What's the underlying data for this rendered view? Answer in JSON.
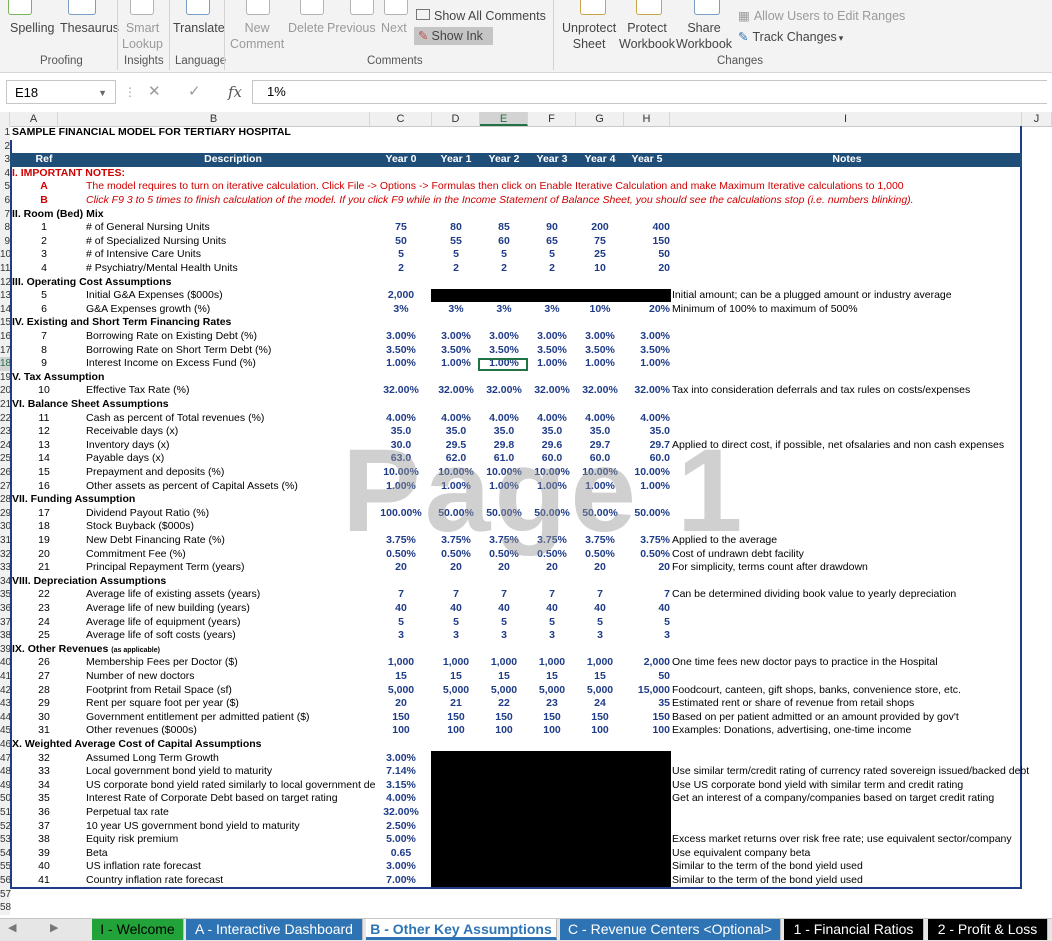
{
  "ribbon": {
    "spelling": "Spelling",
    "thesaurus": "Thesaurus",
    "smart_lookup": [
      "Smart",
      "Lookup"
    ],
    "translate": "Translate",
    "new_comment": [
      "New",
      "Comment"
    ],
    "delete": "Delete",
    "previous": "Previous",
    "next": "Next",
    "show_all_comments": "Show All Comments",
    "show_ink": "Show Ink",
    "unprotect_sheet": [
      "Unprotect",
      "Sheet"
    ],
    "protect_workbook": [
      "Protect",
      "Workbook"
    ],
    "share_workbook": [
      "Share",
      "Workbook"
    ],
    "allow_users": "Allow Users to Edit Ranges",
    "track_changes": "Track Changes",
    "groups": {
      "proofing": "Proofing",
      "insights": "Insights",
      "language": "Language",
      "comments": "Comments",
      "changes": "Changes"
    }
  },
  "formula_bar": {
    "name_box": "E18",
    "formula": "1%",
    "fx": "fx"
  },
  "columns": [
    "A",
    "B",
    "C",
    "D",
    "E",
    "F",
    "G",
    "H",
    "I",
    "J"
  ],
  "selected_cell": {
    "column": "E",
    "row": "18"
  },
  "watermark": "Page 1",
  "rows": [
    {
      "n": "1",
      "a": "SAMPLE FINANCIAL MODEL FOR TERTIARY HOSPITAL",
      "style": "title"
    },
    {
      "n": "2"
    },
    {
      "n": "3",
      "a": "Ref",
      "b": "Description",
      "c": "Year 0",
      "d": "Year 1",
      "e": "Year 2",
      "f": "Year 3",
      "g": "Year 4",
      "h": "Year 5",
      "i": "Notes",
      "style": "header"
    },
    {
      "n": "4",
      "a": "I.  IMPORTANT NOTES:",
      "style": "redsec"
    },
    {
      "n": "5",
      "a": "A",
      "b": "The model requires to turn on iterative calculation. Click File -> Options -> Formulas then click on Enable Iterative Calculation and make Maximum Iterative calculations to 1,000",
      "style": "red"
    },
    {
      "n": "6",
      "a": "B",
      "b": "Click F9 3 to 5 times to finish calculation of the model.  If you click F9 while in the Income Statement of Balance Sheet, you should see the calculations stop (i.e. numbers blinking).",
      "style": "red"
    },
    {
      "n": "7",
      "a": "II. Room (Bed) Mix",
      "style": "sec"
    },
    {
      "n": "8",
      "a": "1",
      "b": "# of General Nursing Units",
      "c": "75",
      "d": "80",
      "e": "85",
      "f": "90",
      "g": "200",
      "h": "400"
    },
    {
      "n": "9",
      "a": "2",
      "b": "# of Specialized Nursing Units",
      "c": "50",
      "d": "55",
      "e": "60",
      "f": "65",
      "g": "75",
      "h": "150"
    },
    {
      "n": "10",
      "a": "3",
      "b": "# of Intensive Care Units",
      "c": "5",
      "d": "5",
      "e": "5",
      "f": "5",
      "g": "25",
      "h": "50"
    },
    {
      "n": "11",
      "a": "4",
      "b": "# Psychiatry/Mental Health Units",
      "c": "2",
      "d": "2",
      "e": "2",
      "f": "2",
      "g": "10",
      "h": "20"
    },
    {
      "n": "12",
      "a": "III.  Operating Cost Assumptions",
      "style": "sec"
    },
    {
      "n": "13",
      "a": "5",
      "b": "Initial G&A Expenses ($000s)",
      "c": "2,000",
      "i": "Initial amount; can be a plugged amount or industry average"
    },
    {
      "n": "14",
      "a": "6",
      "b": "G&A Expenses growth (%)",
      "c": "3%",
      "d": "3%",
      "e": "3%",
      "f": "3%",
      "g": "10%",
      "h": "20%",
      "i": "Minimum of 100% to maximum of 500%"
    },
    {
      "n": "15",
      "a": "IV.  Existing and Short Term Financing Rates",
      "style": "sec"
    },
    {
      "n": "16",
      "a": "7",
      "b": "Borrowing Rate on Existing Debt (%)",
      "c": "3.00%",
      "d": "3.00%",
      "e": "3.00%",
      "f": "3.00%",
      "g": "3.00%",
      "h": "3.00%"
    },
    {
      "n": "17",
      "a": "8",
      "b": "Borrowing Rate on Short Term Debt (%)",
      "c": "3.50%",
      "d": "3.50%",
      "e": "3.50%",
      "f": "3.50%",
      "g": "3.50%",
      "h": "3.50%"
    },
    {
      "n": "18",
      "a": "9",
      "b": "Interest Income on Excess Fund (%)",
      "c": "1.00%",
      "d": "1.00%",
      "e": "1.00%",
      "f": "1.00%",
      "g": "1.00%",
      "h": "1.00%"
    },
    {
      "n": "19",
      "a": "V.  Tax Assumption",
      "style": "sec"
    },
    {
      "n": "20",
      "a": "10",
      "b": "Effective Tax Rate (%)",
      "c": "32.00%",
      "d": "32.00%",
      "e": "32.00%",
      "f": "32.00%",
      "g": "32.00%",
      "h": "32.00%",
      "i": "Tax into consideration deferrals and tax rules on costs/expenses"
    },
    {
      "n": "21",
      "a": "VI.  Balance Sheet Assumptions",
      "style": "sec"
    },
    {
      "n": "22",
      "a": "11",
      "b": "Cash as percent of Total revenues (%)",
      "c": "4.00%",
      "d": "4.00%",
      "e": "4.00%",
      "f": "4.00%",
      "g": "4.00%",
      "h": "4.00%"
    },
    {
      "n": "23",
      "a": "12",
      "b": "Receivable days (x)",
      "c": "35.0",
      "d": "35.0",
      "e": "35.0",
      "f": "35.0",
      "g": "35.0",
      "h": "35.0"
    },
    {
      "n": "24",
      "a": "13",
      "b": "Inventory days (x)",
      "c": "30.0",
      "d": "29.5",
      "e": "29.8",
      "f": "29.6",
      "g": "29.7",
      "h": "29.7",
      "i": "Applied to direct cost, if possible, net ofsalaries and non cash expenses"
    },
    {
      "n": "25",
      "a": "14",
      "b": "Payable days (x)",
      "c": "63.0",
      "d": "62.0",
      "e": "61.0",
      "f": "60.0",
      "g": "60.0",
      "h": "60.0"
    },
    {
      "n": "26",
      "a": "15",
      "b": "Prepayment and deposits (%)",
      "c": "10.00%",
      "d": "10.00%",
      "e": "10.00%",
      "f": "10.00%",
      "g": "10.00%",
      "h": "10.00%"
    },
    {
      "n": "27",
      "a": "16",
      "b": "Other assets as percent of Capital Assets (%)",
      "c": "1.00%",
      "d": "1.00%",
      "e": "1.00%",
      "f": "1.00%",
      "g": "1.00%",
      "h": "1.00%"
    },
    {
      "n": "28",
      "a": "VII.  Funding Assumption",
      "style": "sec"
    },
    {
      "n": "29",
      "a": "17",
      "b": "Dividend Payout Ratio (%)",
      "c": "100.00%",
      "d": "50.00%",
      "e": "50.00%",
      "f": "50.00%",
      "g": "50.00%",
      "h": "50.00%"
    },
    {
      "n": "30",
      "a": "18",
      "b": "Stock Buyback ($000s)"
    },
    {
      "n": "31",
      "a": "19",
      "b": "New Debt Financing Rate (%)",
      "c": "3.75%",
      "d": "3.75%",
      "e": "3.75%",
      "f": "3.75%",
      "g": "3.75%",
      "h": "3.75%",
      "i": "Applied to the average"
    },
    {
      "n": "32",
      "a": "20",
      "b": "Commitment Fee (%)",
      "c": "0.50%",
      "d": "0.50%",
      "e": "0.50%",
      "f": "0.50%",
      "g": "0.50%",
      "h": "0.50%",
      "i": "Cost of undrawn debt facility"
    },
    {
      "n": "33",
      "a": "21",
      "b": "Principal Repayment Term (years)",
      "c": "20",
      "d": "20",
      "e": "20",
      "f": "20",
      "g": "20",
      "h": "20",
      "i": "For simplicity, terms count after drawdown"
    },
    {
      "n": "34",
      "a": "VIII.  Depreciation Assumptions",
      "style": "sec"
    },
    {
      "n": "35",
      "a": "22",
      "b": "Average life of existing assets (years)",
      "c": "7",
      "d": "7",
      "e": "7",
      "f": "7",
      "g": "7",
      "h": "7",
      "i": "Can be determined dividing book value to yearly depreciation"
    },
    {
      "n": "36",
      "a": "23",
      "b": "Average life of new building (years)",
      "c": "40",
      "d": "40",
      "e": "40",
      "f": "40",
      "g": "40",
      "h": "40"
    },
    {
      "n": "37",
      "a": "24",
      "b": "Average life of equipment (years)",
      "c": "5",
      "d": "5",
      "e": "5",
      "f": "5",
      "g": "5",
      "h": "5"
    },
    {
      "n": "38",
      "a": "25",
      "b": "Average life of soft costs (years)",
      "c": "3",
      "d": "3",
      "e": "3",
      "f": "3",
      "g": "3",
      "h": "3"
    },
    {
      "n": "39",
      "a": "IX.  Other Revenues",
      "a_small": "(as applicable)",
      "style": "sec"
    },
    {
      "n": "40",
      "a": "26",
      "b": "Membership Fees per Doctor ($)",
      "c": "1,000",
      "d": "1,000",
      "e": "1,000",
      "f": "1,000",
      "g": "1,000",
      "h": "2,000",
      "i": "One time fees new doctor pays to practice in the Hospital"
    },
    {
      "n": "41",
      "a": "27",
      "b": "Number of new doctors",
      "c": "15",
      "d": "15",
      "e": "15",
      "f": "15",
      "g": "15",
      "h": "50"
    },
    {
      "n": "42",
      "a": "28",
      "b": "Footprint from Retail Space (sf)",
      "c": "5,000",
      "d": "5,000",
      "e": "5,000",
      "f": "5,000",
      "g": "5,000",
      "h": "15,000",
      "i": "Foodcourt, canteen, gift shops, banks, convenience store, etc."
    },
    {
      "n": "43",
      "a": "29",
      "b": "Rent per square foot per year ($)",
      "c": "20",
      "d": "21",
      "e": "22",
      "f": "23",
      "g": "24",
      "h": "35",
      "i": "Estimated rent or share of revenue from retail shops"
    },
    {
      "n": "44",
      "a": "30",
      "b": "Government entitlement per admitted patient ($)",
      "c": "150",
      "d": "150",
      "e": "150",
      "f": "150",
      "g": "150",
      "h": "150",
      "i": "Based on per patient admitted or an amount provided by gov't"
    },
    {
      "n": "45",
      "a": "31",
      "b": "Other revenues ($000s)",
      "c": "100",
      "d": "100",
      "e": "100",
      "f": "100",
      "g": "100",
      "h": "100",
      "i": "Examples: Donations, advertising, one-time income"
    },
    {
      "n": "46",
      "a": "X.  Weighted Average Cost of Capital Assumptions",
      "style": "sec"
    },
    {
      "n": "47",
      "a": "32",
      "b": "Assumed Long Term Growth",
      "c": "3.00%"
    },
    {
      "n": "48",
      "a": "33",
      "b": "Local government bond yield to maturity",
      "c": "7.14%",
      "i": "Use similar term/credit rating of currency rated sovereign issued/backed debt"
    },
    {
      "n": "49",
      "a": "34",
      "b": "US corporate bond yield rated similarly to local government de",
      "c": "3.15%",
      "i": "Use US corporate bond yield with similar term and credit rating"
    },
    {
      "n": "50",
      "a": "35",
      "b": "Interest Rate of Corporate Debt based on target rating",
      "c": "4.00%",
      "i": "Get an interest of a company/companies based on target credit rating"
    },
    {
      "n": "51",
      "a": "36",
      "b": "Perpetual tax rate",
      "c": "32.00%"
    },
    {
      "n": "52",
      "a": "37",
      "b": "10 year US government bond yield to maturity",
      "c": "2.50%"
    },
    {
      "n": "53",
      "a": "38",
      "b": "Equity risk premium",
      "c": "5.00%",
      "i": "Excess market returns over risk free rate;  use equivalent sector/company"
    },
    {
      "n": "54",
      "a": "39",
      "b": "Beta",
      "c": "0.65",
      "i": "Use equivalent company beta"
    },
    {
      "n": "55",
      "a": "40",
      "b": "US inflation rate forecast",
      "c": "3.00%",
      "i": "Similar to the term of the bond yield used"
    },
    {
      "n": "56",
      "a": "41",
      "b": "Country inflation rate forecast",
      "c": "7.00%",
      "i": "Similar to the term of the bond yield used"
    },
    {
      "n": "57"
    },
    {
      "n": "58"
    }
  ],
  "tabs": [
    {
      "label": "I - Welcome",
      "bg": "#21a33a",
      "fg": "#000000"
    },
    {
      "label": "A - Interactive Dashboard",
      "bg": "#2e74b5",
      "fg": "#ffffff"
    },
    {
      "label": "B - Other Key Assumptions",
      "bg": "#ffffff",
      "fg": "#2e74b5",
      "active": true
    },
    {
      "label": "C - Revenue Centers <Optional>",
      "bg": "#2e74b5",
      "fg": "#ffffff"
    },
    {
      "label": "1 - Financial Ratios",
      "bg": "#000000",
      "fg": "#ffffff"
    },
    {
      "label": "2 - Profit & Loss",
      "bg": "#000000",
      "fg": "#ffffff"
    }
  ],
  "colors": {
    "header_blue": "#1f4e79",
    "input_blue": "#1f3c88",
    "note_red": "#d00000",
    "excel_green": "#217346"
  }
}
